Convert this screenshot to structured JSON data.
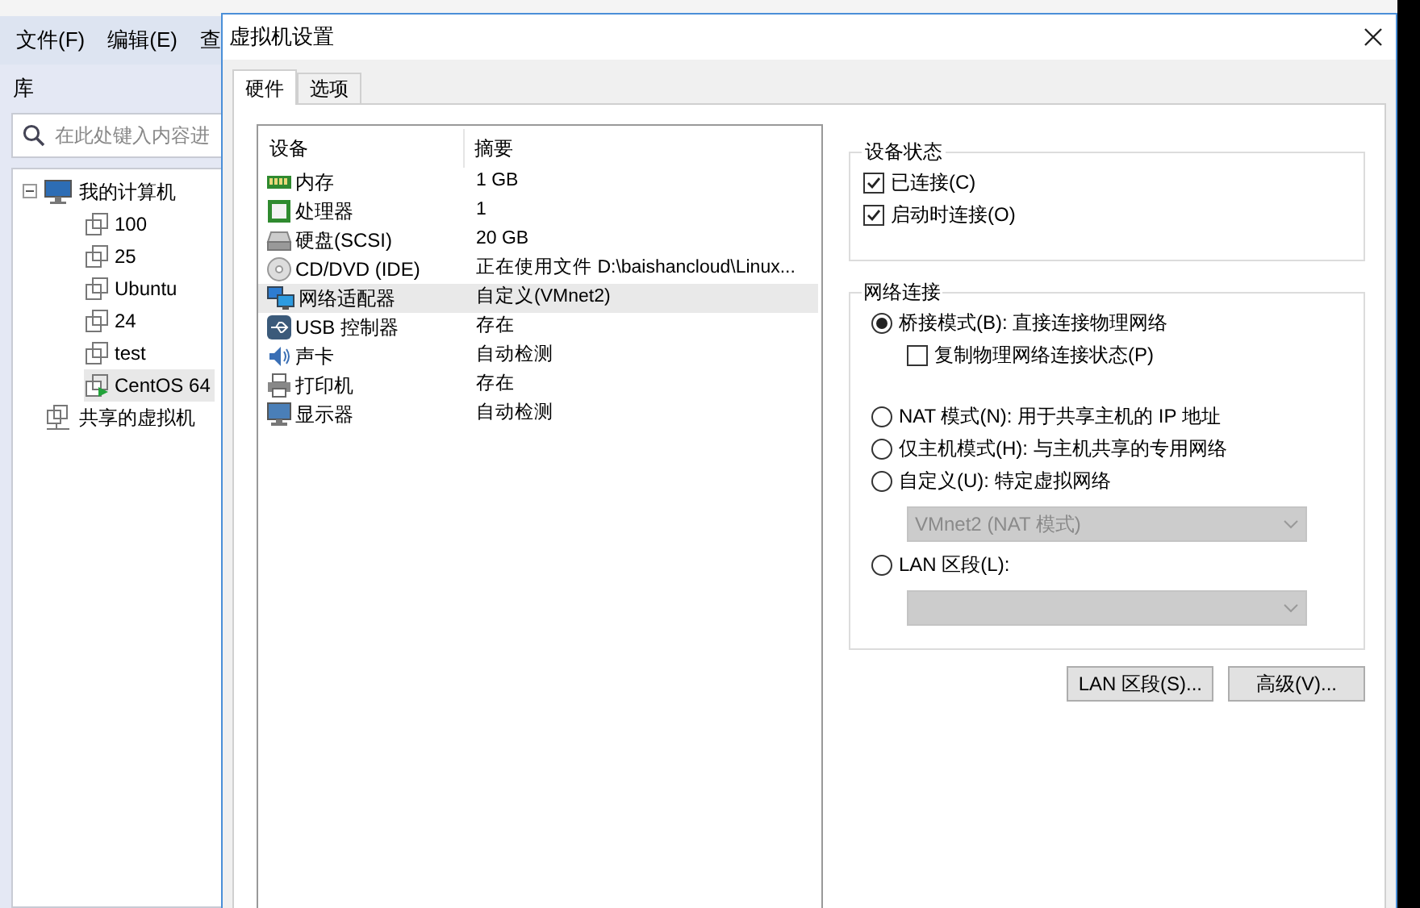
{
  "background_app": {
    "menu": [
      "文件(F)",
      "编辑(E)",
      "查"
    ],
    "library_title": "库",
    "search": {
      "placeholder": "在此处键入内容进"
    },
    "tree": [
      {
        "label": "我的计算机",
        "kind": "computer",
        "expanded": true,
        "selected": false,
        "children": [
          {
            "label": "100",
            "kind": "vm",
            "running": false,
            "selected": false
          },
          {
            "label": "25",
            "kind": "vm",
            "running": false,
            "selected": false
          },
          {
            "label": "Ubuntu",
            "kind": "vm",
            "running": false,
            "selected": false
          },
          {
            "label": "24",
            "kind": "vm",
            "running": false,
            "selected": false
          },
          {
            "label": "test",
            "kind": "vm",
            "running": false,
            "selected": false
          },
          {
            "label": "CentOS 64",
            "kind": "vm",
            "running": true,
            "selected": true
          }
        ]
      },
      {
        "label": "共享的虚拟机",
        "kind": "shared",
        "selected": false
      }
    ]
  },
  "dialog": {
    "title": "虚拟机设置",
    "tabs": [
      {
        "label": "硬件",
        "selected": true
      },
      {
        "label": "选项",
        "selected": false
      }
    ],
    "devices": {
      "columns": [
        "设备",
        "摘要"
      ],
      "rows": [
        {
          "device": "内存",
          "summary": "1 GB",
          "kind": "memory",
          "selected": false
        },
        {
          "device": "处理器",
          "summary": "1",
          "kind": "cpu",
          "selected": false
        },
        {
          "device": "硬盘(SCSI)",
          "summary": "20 GB",
          "kind": "disk",
          "selected": false
        },
        {
          "device": "CD/DVD (IDE)",
          "summary": "正在使用文件 D:\\baishancloud\\Linux...",
          "kind": "cd",
          "selected": false
        },
        {
          "device": "网络适配器",
          "summary": "自定义(VMnet2)",
          "kind": "network",
          "selected": true
        },
        {
          "device": "USB 控制器",
          "summary": "存在",
          "kind": "usb",
          "selected": false
        },
        {
          "device": "声卡",
          "summary": "自动检测",
          "kind": "sound",
          "selected": false
        },
        {
          "device": "打印机",
          "summary": "存在",
          "kind": "printer",
          "selected": false
        },
        {
          "device": "显示器",
          "summary": "自动检测",
          "kind": "display",
          "selected": false
        }
      ]
    },
    "device_status": {
      "title": "设备状态",
      "options": [
        {
          "label": "已连接(C)",
          "checked": true
        },
        {
          "label": "启动时连接(O)",
          "checked": true
        }
      ]
    },
    "network": {
      "title": "网络连接",
      "options": [
        {
          "label": "桥接模式(B): 直接连接物理网络",
          "selected": true,
          "sub_option": {
            "label": "复制物理网络连接状态(P)",
            "checked": false
          }
        },
        {
          "label": "NAT 模式(N): 用于共享主机的 IP 地址",
          "selected": false
        },
        {
          "label": "仅主机模式(H): 与主机共享的专用网络",
          "selected": false
        },
        {
          "label": "自定义(U): 特定虚拟网络",
          "selected": false,
          "dropdown": {
            "value": "VMnet2 (NAT 模式)",
            "disabled": true
          }
        },
        {
          "label": "LAN 区段(L):",
          "selected": false,
          "dropdown": {
            "disabled": true
          }
        }
      ]
    },
    "buttons": [
      "LAN 区段(S)...",
      "高级(V)..."
    ]
  }
}
